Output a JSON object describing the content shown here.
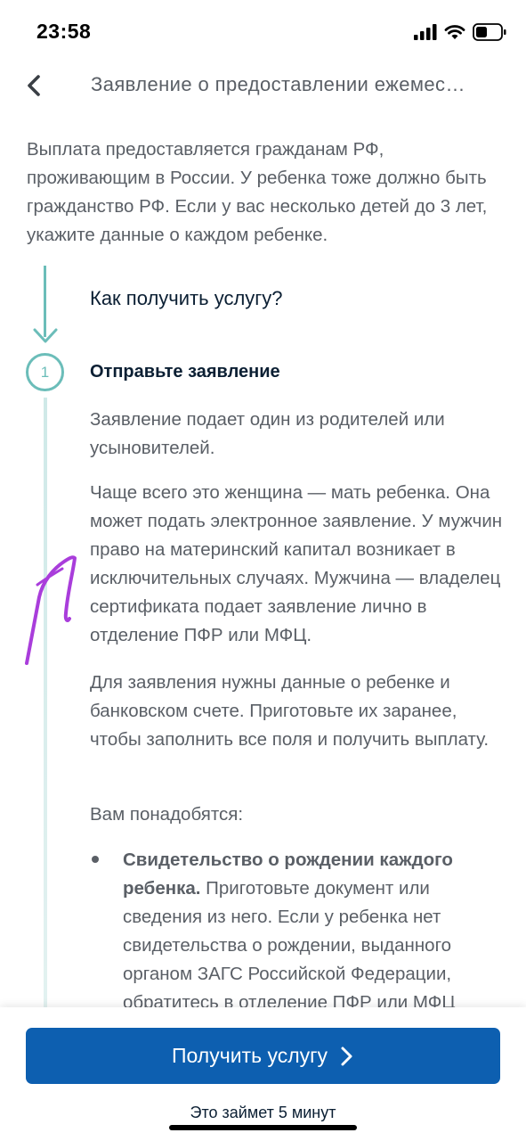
{
  "status_bar": {
    "time": "23:58",
    "icons": [
      "signal-icon",
      "wifi-icon",
      "battery-icon"
    ]
  },
  "header": {
    "back_icon": "chevron-left-icon",
    "title": "Заявление о предоставлении ежемес…"
  },
  "intro": "Выплата предоставляется гражданам РФ, проживающим в России. У ребенка тоже должно быть гражданство РФ. Если у вас несколько детей до 3 лет, укажите данные о каждом ребенке.",
  "how_title": "Как получить услугу?",
  "step": {
    "number": "1",
    "title": "Отправьте заявление",
    "paragraphs": [
      "Заявление подает один из родителей или усыновителей.",
      "Чаще всего это женщина — мать ребенка. Она может подать электронное заявление. У мужчин право на материнский капитал возникает в исключительных случаях. Мужчина — владелец сертификата подает заявление лично в отделение ПФР или МФЦ.",
      "Для заявления нужны данные о ребенке и банковском счете. Приготовьте их заранее, чтобы заполнить все поля и получить выплату.",
      "Вам понадобятся:"
    ],
    "bullet": {
      "bold": "Свидетельство о рождении каждого ребенка.",
      "text": " Приготовьте документ или сведения из него. Если у ребенка нет свидетельства о рождении, выданного органом ЗАГС Российской Федерации, обратитесь в отделение ПФР или МФЦ"
    }
  },
  "cta": {
    "label": "Получить услугу",
    "duration": "Это займет 5 минут"
  },
  "colors": {
    "accent_teal": "#6bbdb9",
    "button_blue": "#0d5fb0",
    "annotation_purple": "#a93ddb"
  }
}
